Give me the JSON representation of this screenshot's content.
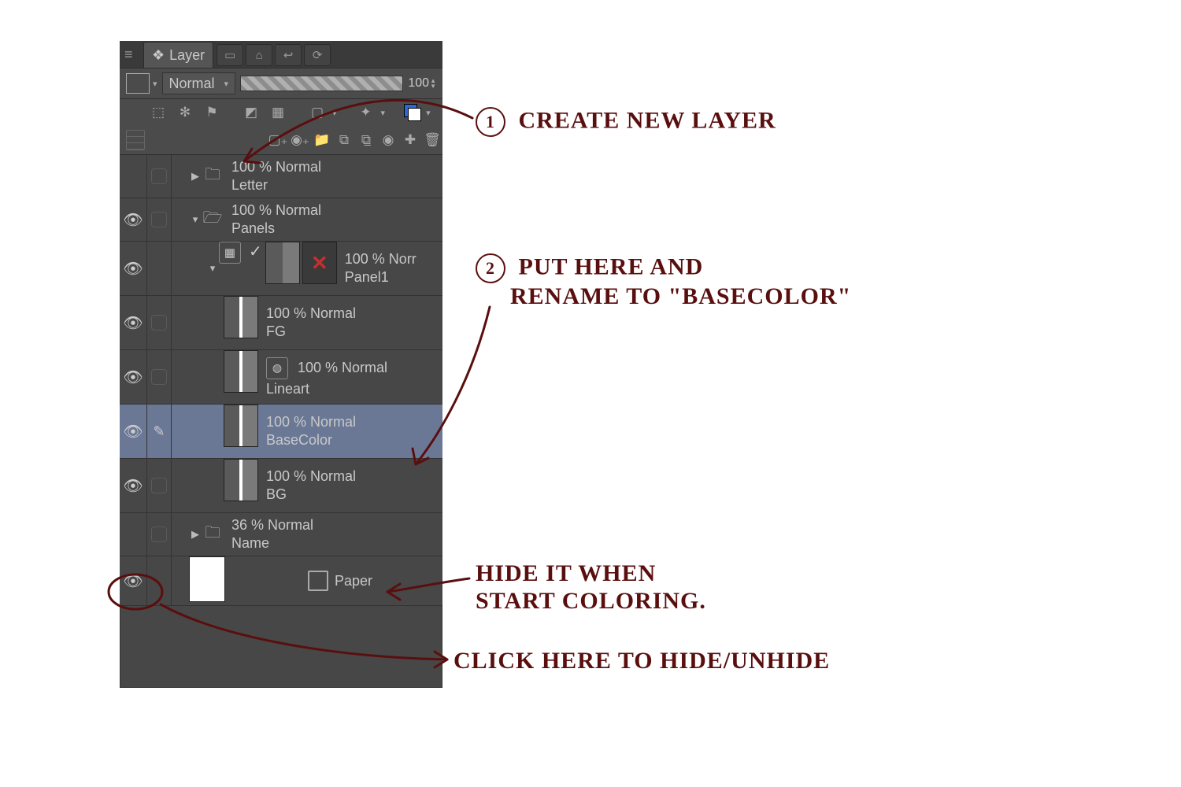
{
  "tabs": {
    "active_label": "Layer"
  },
  "blend_row": {
    "mode": "Normal",
    "opacity": "100"
  },
  "layers": {
    "letter": {
      "info": "100 % Normal",
      "name": "Letter"
    },
    "panels": {
      "info": "100 % Normal",
      "name": "Panels"
    },
    "panel1": {
      "info": "100 % Norr",
      "name": "Panel1"
    },
    "fg": {
      "info": "100 % Normal",
      "name": "FG"
    },
    "lineart": {
      "info": "100 % Normal",
      "name": "Lineart"
    },
    "basecolor": {
      "info": "100 % Normal",
      "name": "BaseColor"
    },
    "bg": {
      "info": "100 % Normal",
      "name": "BG"
    },
    "namef": {
      "info": "36 % Normal",
      "name": "Name"
    },
    "paper": {
      "name": "Paper"
    }
  },
  "annotations": {
    "a1": "CREATE NEW LAYER",
    "a2a": "PUT HERE AND",
    "a2b": "RENAME TO \"BASECOLOR\"",
    "a3a": "HIDE IT WHEN",
    "a3b": "START COLORING.",
    "a4": "CLICK HERE  TO HIDE/UNHIDE"
  }
}
